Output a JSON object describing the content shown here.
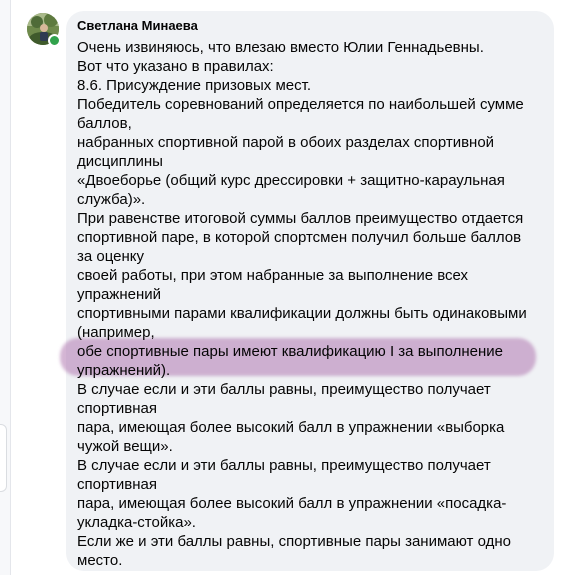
{
  "comment": {
    "author": "Светлана Минаева",
    "lines": [
      "Очень извиняюсь, что влезаю вместо Юлии Геннадьевны.",
      "Вот что указано в правилах:",
      "8.6. Присуждение призовых мест.",
      "Победитель соревнований определяется по наибольшей сумме",
      "баллов,",
      "набранных спортивной парой в обоих разделах спортивной",
      "дисциплины",
      "«Двоеборье (общий курс дрессировки + защитно-караульная",
      "служба)».",
      "При равенстве итоговой суммы баллов преимущество отдается",
      "спортивной паре, в которой спортсмен получил больше баллов",
      "за оценку",
      "своей работы, при этом набранные за выполнение всех",
      "упражнений",
      "спортивными парами квалификации должны быть одинаковыми",
      "(например,",
      "обе спортивные пары имеют квалификацию I за выполнение",
      "упражнений).",
      "В случае если и эти баллы равны, преимущество получает",
      "спортивная",
      "пара, имеющая более высокий балл в упражнении «выборка",
      "чужой вещи».",
      "В случае если и эти баллы равны, преимущество получает",
      "спортивная",
      "пара, имеющая более высокий балл в упражнении «посадка-",
      "укладка-стойка».",
      "Если же и эти баллы равны, спортивные пары занимают одно",
      "место."
    ]
  },
  "colors": {
    "bubble": "#f0f2f5",
    "text": "#050505",
    "highlight": "#b078b0",
    "online": "#31a24c"
  },
  "icons": {
    "avatar": "user-avatar-photo",
    "status": "online-status-dot"
  }
}
